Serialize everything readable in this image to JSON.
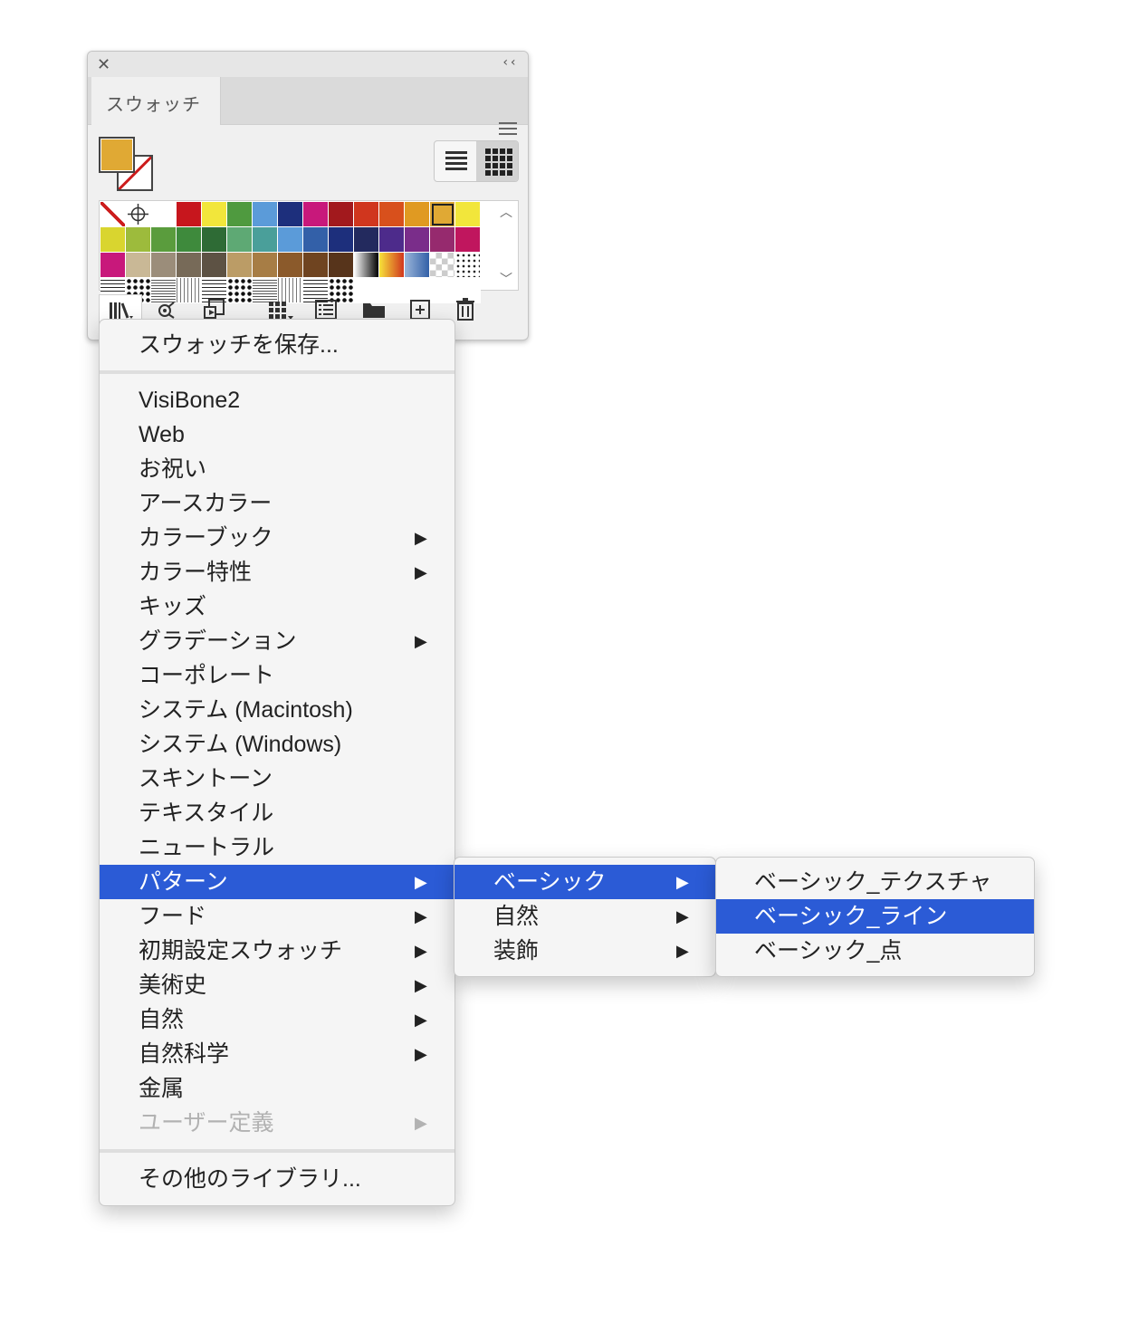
{
  "panel": {
    "tab_label": "スウォッチ",
    "close_glyph": "✕",
    "collapse_glyph": "‹‹",
    "scroll_up_glyph": "︿",
    "scroll_down_glyph": "﹀",
    "fill_color": "#e0a934"
  },
  "swatches": [
    [
      "none",
      "registration",
      "#ffffff",
      "#c7161d",
      "#f2e63b",
      "#4f9a3f",
      "#5b9bd9",
      "#1d2f7c",
      "#c8187b",
      "#a2191d",
      "#d0361e",
      "#d8501c",
      "#e09a22",
      "#e0a934",
      "#f2e63b"
    ],
    [
      "#d9d52f",
      "#9dbb3c",
      "#5a9c3d",
      "#3e8a3c",
      "#2e6b35",
      "#5ea974",
      "#4a9f9a",
      "#5b9bd9",
      "#3360a8",
      "#1d2f7c",
      "#232a5e",
      "#4d2b8b",
      "#7a2d8a",
      "#962a6e",
      "#c0165e"
    ],
    [
      "#c8187b",
      "#c9b896",
      "#9b8d7a",
      "#776a58",
      "#5d5244",
      "#bb9c66",
      "#a77d45",
      "#8b5a2b",
      "#6f4420",
      "#57341b",
      "gradient-bw",
      "gradient-yellow",
      "gradient-blue",
      "checker",
      "dots"
    ],
    [
      "pattern",
      "pattern",
      "pattern",
      "pattern",
      "pattern",
      "pattern",
      "pattern",
      "pattern",
      "pattern",
      "pattern",
      "",
      "",
      "",
      "",
      ""
    ]
  ],
  "library_menu": {
    "top": "スウォッチを保存...",
    "items": [
      {
        "label": "VisiBone2",
        "submenu": false
      },
      {
        "label": "Web",
        "submenu": false
      },
      {
        "label": "お祝い",
        "submenu": false
      },
      {
        "label": "アースカラー",
        "submenu": false
      },
      {
        "label": "カラーブック",
        "submenu": true
      },
      {
        "label": "カラー特性",
        "submenu": true
      },
      {
        "label": "キッズ",
        "submenu": false
      },
      {
        "label": "グラデーション",
        "submenu": true
      },
      {
        "label": "コーポレート",
        "submenu": false
      },
      {
        "label": "システム (Macintosh)",
        "submenu": false
      },
      {
        "label": "システム (Windows)",
        "submenu": false
      },
      {
        "label": "スキントーン",
        "submenu": false
      },
      {
        "label": "テキスタイル",
        "submenu": false
      },
      {
        "label": "ニュートラル",
        "submenu": false
      },
      {
        "label": "パターン",
        "submenu": true,
        "highlighted": true
      },
      {
        "label": "フード",
        "submenu": true
      },
      {
        "label": "初期設定スウォッチ",
        "submenu": true
      },
      {
        "label": "美術史",
        "submenu": true
      },
      {
        "label": "自然",
        "submenu": true
      },
      {
        "label": "自然科学",
        "submenu": true
      },
      {
        "label": "金属",
        "submenu": false
      },
      {
        "label": "ユーザー定義",
        "submenu": true,
        "disabled": true
      }
    ],
    "bottom": "その他のライブラリ..."
  },
  "pattern_menu": {
    "items": [
      {
        "label": "ベーシック",
        "submenu": true,
        "highlighted": true
      },
      {
        "label": "自然",
        "submenu": true
      },
      {
        "label": "装飾",
        "submenu": true
      }
    ]
  },
  "basic_menu": {
    "items": [
      {
        "label": "ベーシック_テクスチャ"
      },
      {
        "label": "ベーシック_ライン",
        "highlighted": true
      },
      {
        "label": "ベーシック_点"
      }
    ]
  },
  "submenu_arrow": "▶",
  "highlight_color": "#2b5bd6"
}
